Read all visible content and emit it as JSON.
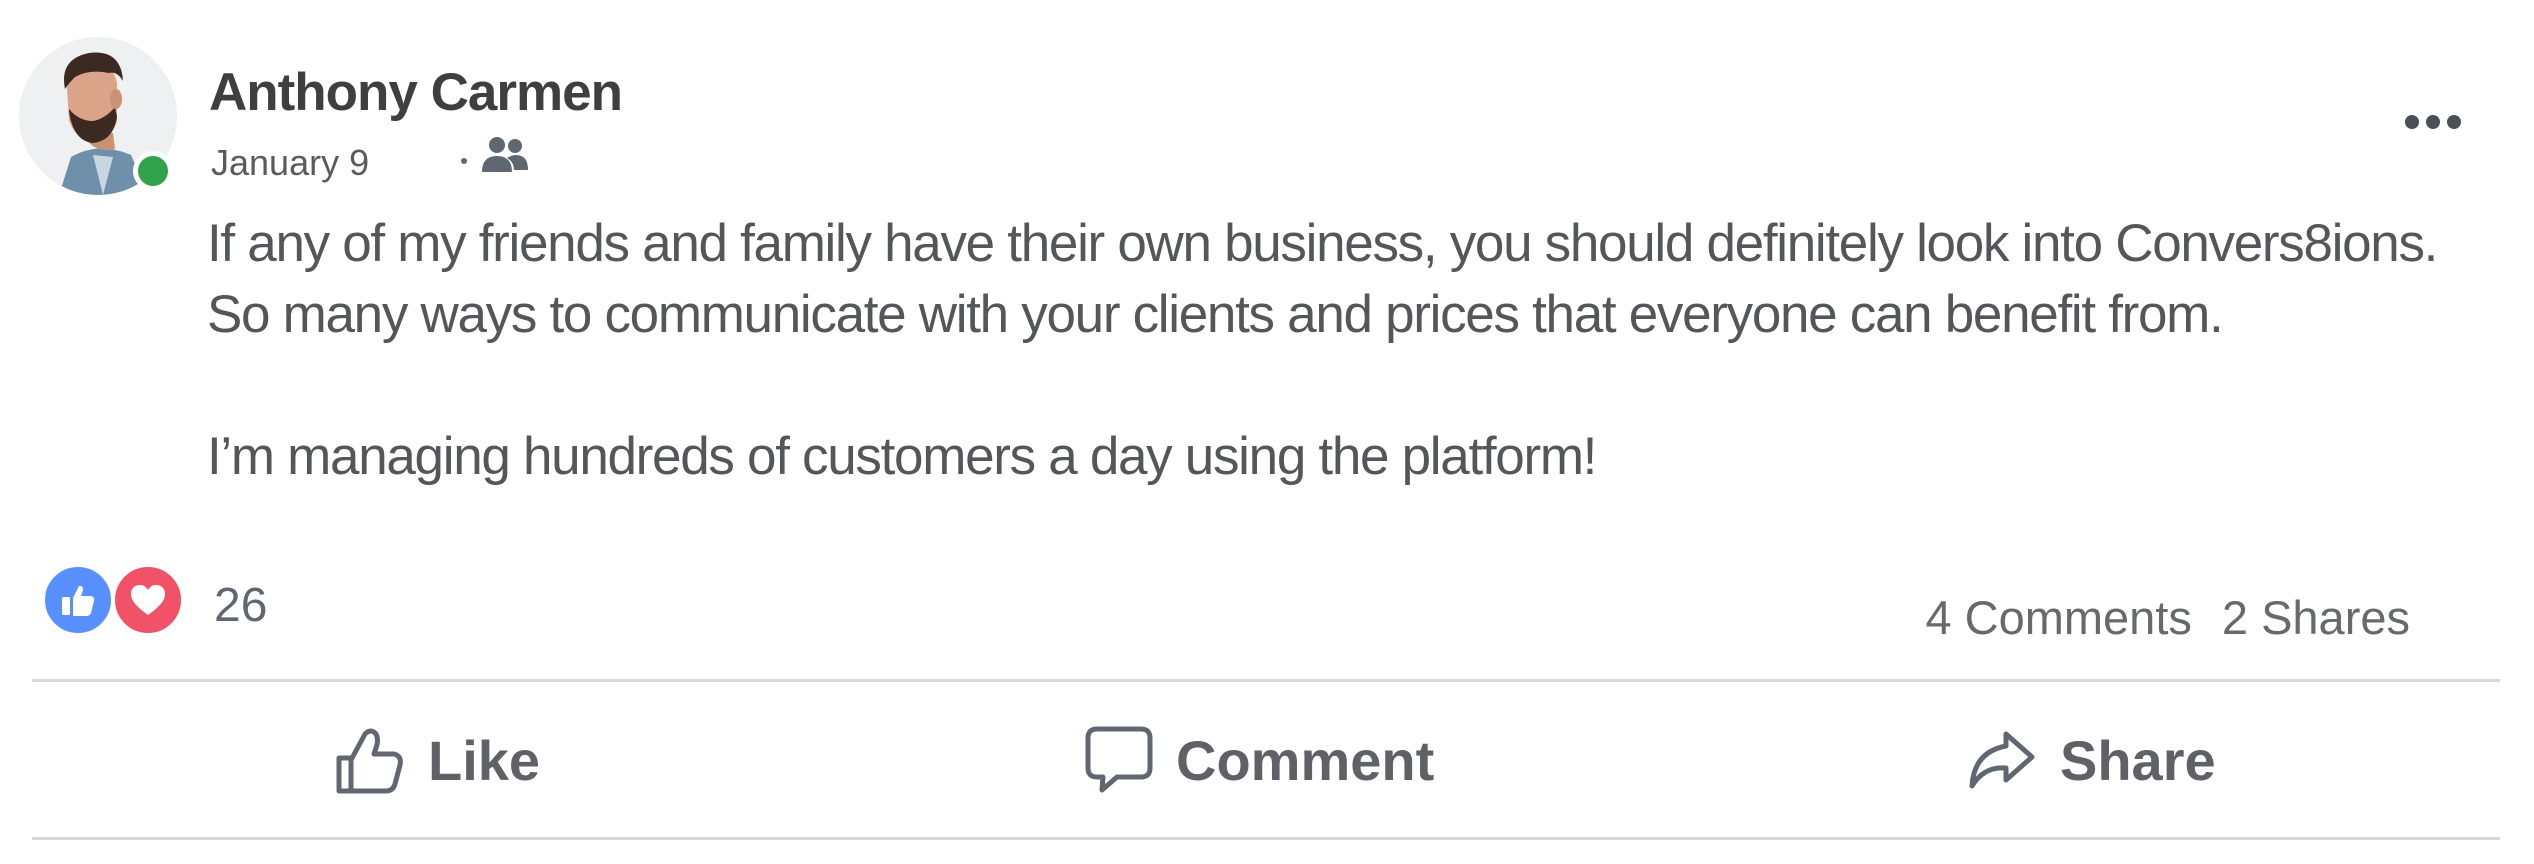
{
  "post": {
    "author": "Anthony Carmen",
    "date": "January 9",
    "audience_icon": "friends-icon",
    "online": true,
    "text_lines": [
      "If any of my friends and family have their own business, you should definitely look into Convers8ions.",
      "So many ways to communicate with your clients and prices that everyone can benefit from.",
      "I’m managing hundreds of customers a day using the platform!"
    ]
  },
  "reactions": {
    "types": [
      "like-reaction-icon",
      "love-reaction-icon"
    ],
    "count": "26"
  },
  "stats": {
    "comments": "4 Comments",
    "shares": "2 Shares"
  },
  "actions": {
    "like": "Like",
    "comment": "Comment",
    "share": "Share"
  },
  "colors": {
    "online": "#31a24c",
    "like_reaction": "#5890ff",
    "love_reaction": "#f25268",
    "text": "#55565a"
  }
}
